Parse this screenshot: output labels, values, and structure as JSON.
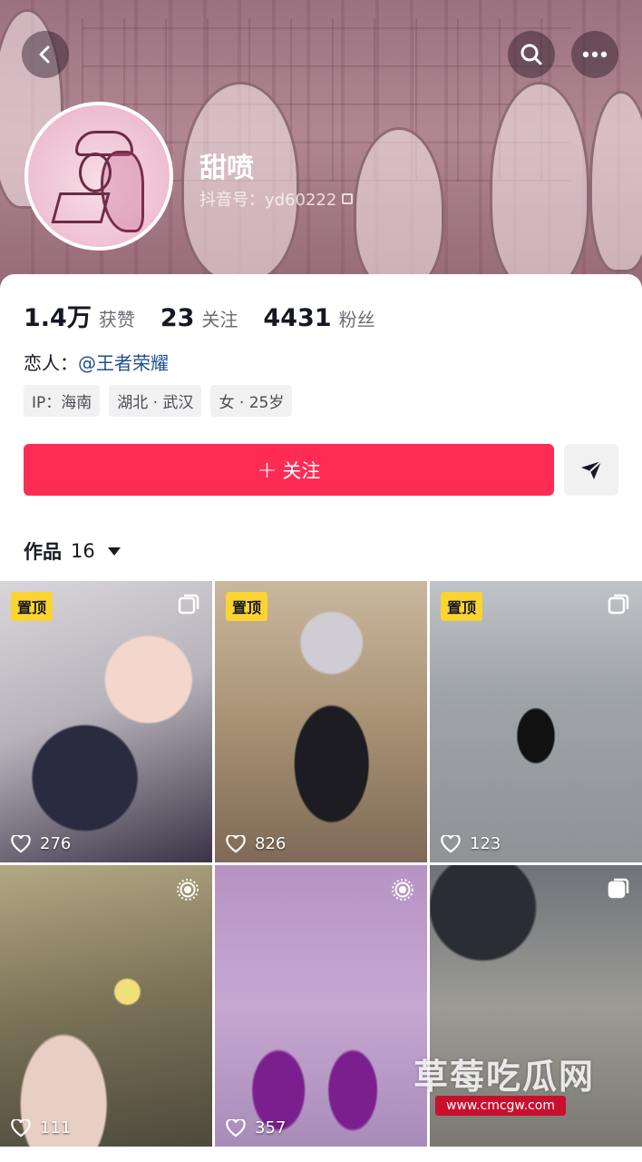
{
  "profile": {
    "name": "甜喷",
    "douyin_id": "抖音号：yd60222"
  },
  "stats": [
    {
      "num": "1.4万",
      "label": "获赞"
    },
    {
      "num": "23",
      "label": "关注"
    },
    {
      "num": "4431",
      "label": "粉丝"
    }
  ],
  "lover": {
    "prefix": "恋人：",
    "mention": "@王者荣耀"
  },
  "tags": [
    "IP：海南",
    "湖北 · 武汉",
    "女 · 25岁"
  ],
  "follow_button": {
    "label": "关注",
    "color": "#fe2c55"
  },
  "works": {
    "label": "作品",
    "count": "16"
  },
  "videos": [
    {
      "likes": "276",
      "pinned": "置顶"
    },
    {
      "likes": "826",
      "pinned": "置顶"
    },
    {
      "likes": "123",
      "pinned": "置顶"
    },
    {
      "likes": "111"
    },
    {
      "likes": "357"
    },
    {
      "likes": ""
    }
  ],
  "watermark": {
    "text": "草莓吃瓜网",
    "url": "www.cmcgw.com"
  },
  "icons": [
    "back-icon",
    "search-icon",
    "more-icon",
    "copy-icon",
    "send-icon",
    "heart-icon",
    "multi-image-icon",
    "live-photo-icon"
  ]
}
